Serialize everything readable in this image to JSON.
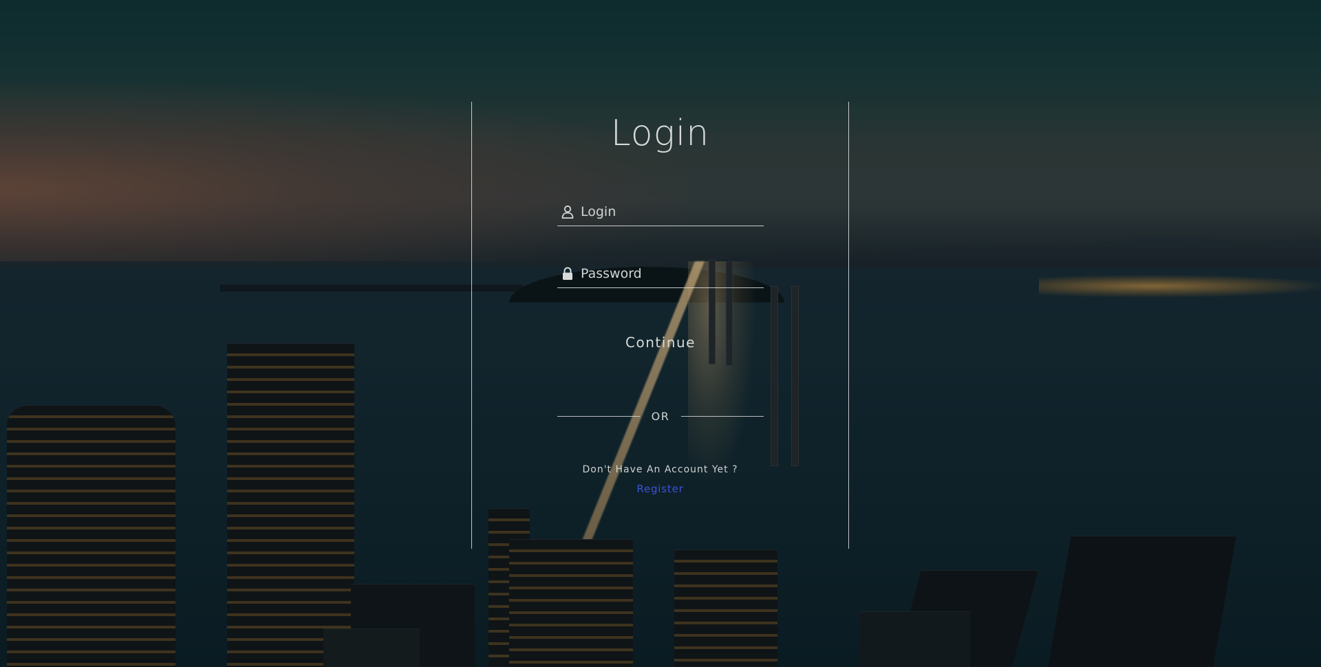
{
  "login_form": {
    "title": "Login",
    "login_field": {
      "placeholder": "Login",
      "value": "",
      "icon": "user-icon"
    },
    "password_field": {
      "placeholder": "Password",
      "value": "",
      "icon": "lock-icon"
    },
    "continue_label": "Continue",
    "divider_text": "OR",
    "no_account_text": "Don't Have An Account Yet ?",
    "register_label": "Register"
  },
  "colors": {
    "text": "#d6dad9",
    "link": "#3a53d8",
    "panel_border": "#ffffff"
  }
}
